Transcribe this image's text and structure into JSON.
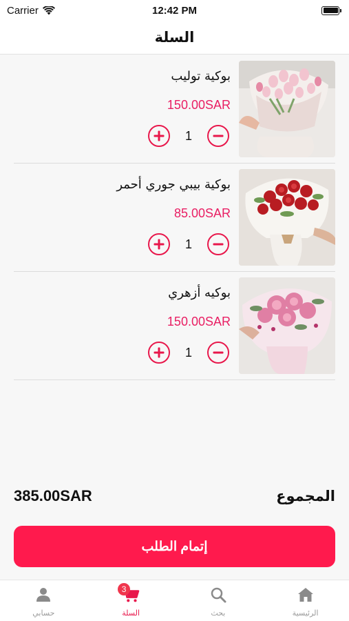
{
  "status_bar": {
    "carrier": "Carrier",
    "time": "12:42 PM"
  },
  "header": {
    "title": "السلة"
  },
  "items": [
    {
      "name": "بوكية توليب",
      "price": "150.00SAR",
      "quantity": "1",
      "image": "tulip-bouquet"
    },
    {
      "name": "بوكية بيبي جوري أحمر",
      "price": "85.00SAR",
      "quantity": "1",
      "image": "red-roses-bouquet"
    },
    {
      "name": "بوكيه أزهري",
      "price": "150.00SAR",
      "quantity": "1",
      "image": "pink-hydrangea-bouquet"
    }
  ],
  "summary": {
    "total_label": "المجموع",
    "total_amount": "385.00SAR"
  },
  "checkout": {
    "label": "إتمام الطلب"
  },
  "tabs": [
    {
      "label": "حسابي",
      "icon": "person-icon",
      "active": false
    },
    {
      "label": "السلة",
      "icon": "cart-icon",
      "active": true,
      "badge": "3"
    },
    {
      "label": "بحث",
      "icon": "search-icon",
      "active": false
    },
    {
      "label": "الرئيسية",
      "icon": "home-icon",
      "active": false
    }
  ],
  "colors": {
    "accent": "#e8174b",
    "checkout": "#ff1a4d",
    "price": "#e91e63"
  }
}
